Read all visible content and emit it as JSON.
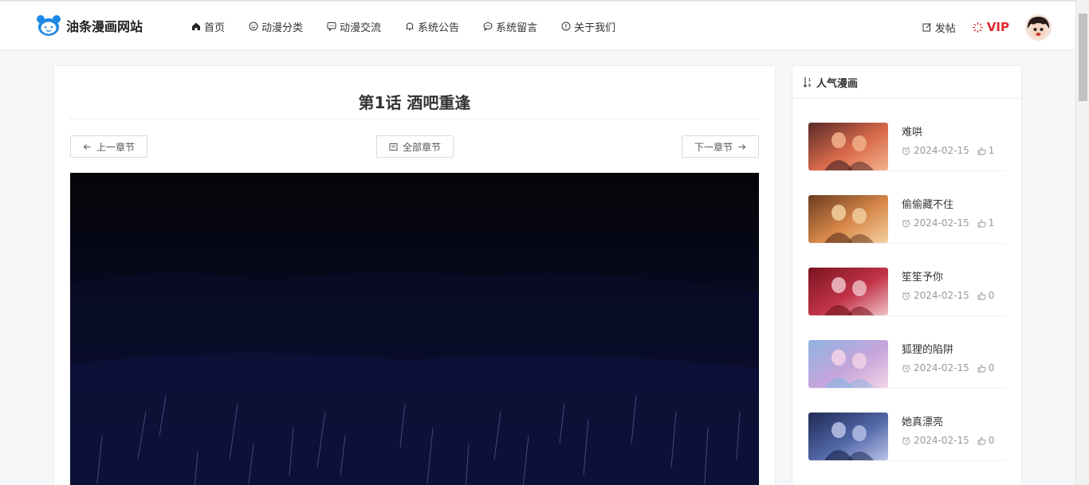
{
  "header": {
    "site_name": "油条漫画网站",
    "nav": [
      {
        "label": "首页",
        "icon": "home-icon"
      },
      {
        "label": "动漫分类",
        "icon": "smile-icon"
      },
      {
        "label": "动漫交流",
        "icon": "chat-icon"
      },
      {
        "label": "系统公告",
        "icon": "bell-icon"
      },
      {
        "label": "系统留言",
        "icon": "message-icon"
      },
      {
        "label": "关于我们",
        "icon": "info-icon"
      }
    ],
    "post_label": "发帖",
    "vip_label": "VIP"
  },
  "chapter": {
    "title": "第1话 酒吧重逢",
    "prev_label": "上一章节",
    "all_label": "全部章节",
    "next_label": "下一章节"
  },
  "sidebar": {
    "title": "人气漫画",
    "items": [
      {
        "title": "难哄",
        "date": "2024-02-15",
        "likes": "1",
        "colors": [
          "#5a2a2a",
          "#d96a4a",
          "#f2b28c"
        ]
      },
      {
        "title": "偷偷藏不住",
        "date": "2024-02-15",
        "likes": "1",
        "colors": [
          "#6b3b1f",
          "#d8894a",
          "#f3d0a1"
        ]
      },
      {
        "title": "笙笙予你",
        "date": "2024-02-15",
        "likes": "0",
        "colors": [
          "#7a1420",
          "#c23448",
          "#f0c2c8"
        ]
      },
      {
        "title": "狐狸的陷阱",
        "date": "2024-02-15",
        "likes": "0",
        "colors": [
          "#8fb3e0",
          "#c6a5dc",
          "#f4d3e6"
        ]
      },
      {
        "title": "她真漂亮",
        "date": "2024-02-15",
        "likes": "0",
        "colors": [
          "#1f2a55",
          "#5268a8",
          "#b9c3e6"
        ]
      }
    ]
  },
  "colors": {
    "accent": "#1e88e5",
    "vip": "#e3262e"
  }
}
